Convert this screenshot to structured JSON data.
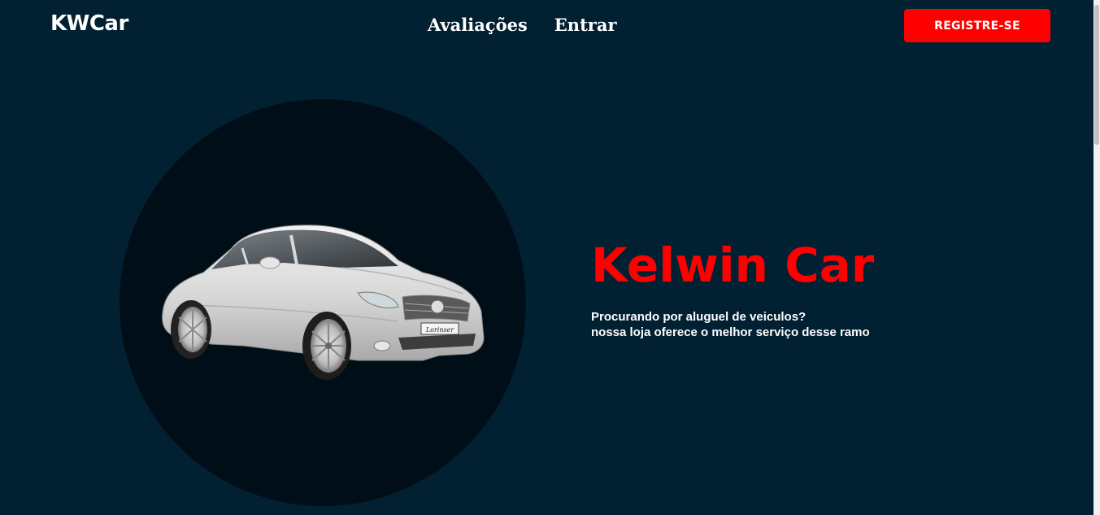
{
  "header": {
    "logo": "KWCar",
    "nav": [
      {
        "label": "Avaliações"
      },
      {
        "label": "Entrar"
      }
    ],
    "register_label": "REGISTRE-SE"
  },
  "hero": {
    "title": "Kelwin Car",
    "description_line1": "Procurando por aluguel de veiculos?",
    "description_line2": "nossa loja oferece o melhor serviço desse ramo",
    "image_alt": "car-image",
    "license_plate": "Lorinser"
  },
  "colors": {
    "background": "#012032",
    "circle": "#000e17",
    "accent": "#ff0000",
    "text": "#ffffff"
  }
}
